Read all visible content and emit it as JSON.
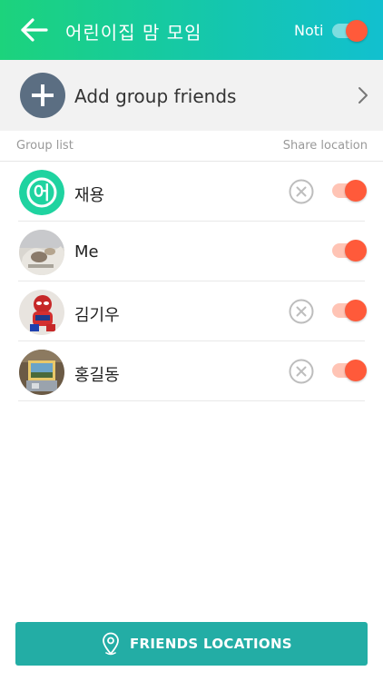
{
  "header": {
    "title": "어린이집 맘 모임",
    "noti_label": "Noti",
    "noti_enabled": true,
    "gradient_colors": [
      "#1cd37c",
      "#12c0cf"
    ]
  },
  "add_friends": {
    "label": "Add group friends"
  },
  "list_header": {
    "left": "Group list",
    "right": "Share location"
  },
  "members": [
    {
      "name": "재용",
      "avatar": "mint-logo-avatar",
      "logo_text": "어",
      "removable": true,
      "share_location": true
    },
    {
      "name": "Me",
      "avatar": "photo-avatar",
      "removable": false,
      "share_location": true
    },
    {
      "name": "김기우",
      "avatar": "spiderman-figure-avatar",
      "removable": true,
      "share_location": true
    },
    {
      "name": "홍길동",
      "avatar": "painting-avatar",
      "removable": true,
      "share_location": true
    }
  ],
  "bottom_button": {
    "label": "FRIENDS LOCATIONS",
    "icon": "location-pin-icon"
  },
  "colors": {
    "accent_orange": "#ff5a3a",
    "toggle_track": "#ffc4b5",
    "button_teal": "#23ada5",
    "add_icon_bg": "#5b6e82"
  }
}
